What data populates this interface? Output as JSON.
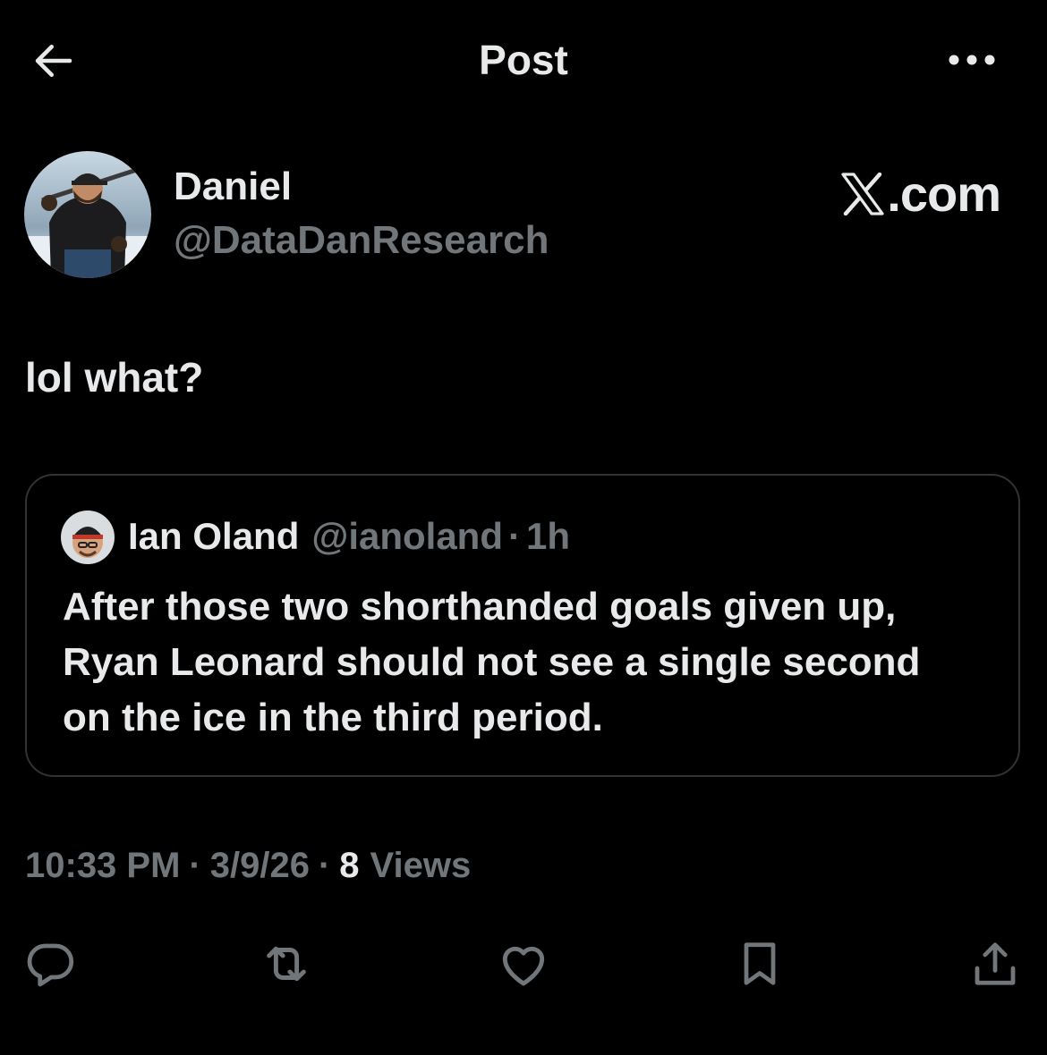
{
  "header": {
    "title": "Post"
  },
  "author": {
    "name": "Daniel",
    "handle": "@DataDanResearch"
  },
  "watermark": ".com",
  "post": {
    "text": "lol what?"
  },
  "quote": {
    "name": "Ian Oland",
    "handle": "@ianoland",
    "separator": "·",
    "time": "1h",
    "lines": [
      "After those two shorthanded goals given up,",
      "Ryan Leonard should not see a single second",
      "on the ice in the third period."
    ]
  },
  "meta": {
    "time": "10:33 PM",
    "separator": "·",
    "date": "3/9/26",
    "views_count": "8",
    "views_label": "Views"
  },
  "icons": {
    "back": "back-arrow-icon",
    "more": "more-horizontal-icon",
    "x_logo": "x-logo-icon",
    "reply": "reply-icon",
    "repost": "repost-icon",
    "like": "heart-icon",
    "bookmark": "bookmark-icon",
    "share": "share-icon"
  },
  "colors": {
    "background": "#000000",
    "text_primary": "#e7e9ea",
    "text_secondary": "#71767b",
    "border": "#2f3336"
  }
}
